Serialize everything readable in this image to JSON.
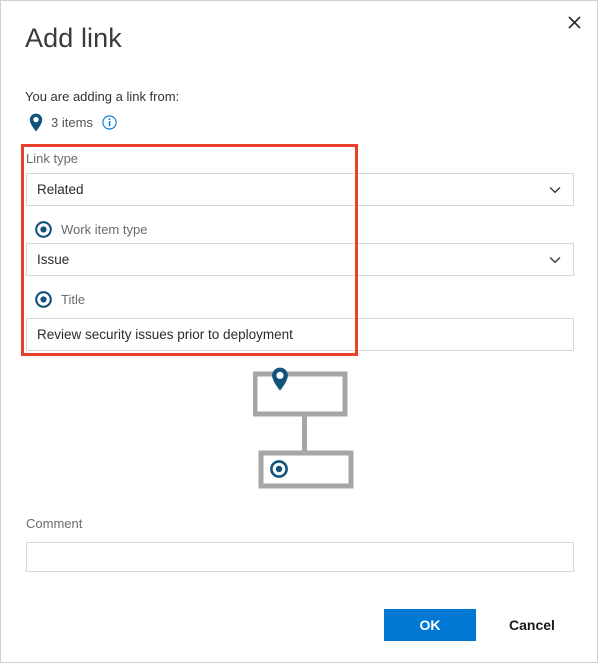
{
  "dialog": {
    "title": "Add link",
    "close_label": "Close"
  },
  "source": {
    "description": "You are adding a link from:",
    "items_count_label": "3 items",
    "pin_icon": "map-pin-icon",
    "info_icon": "info-circle-icon"
  },
  "form": {
    "link_type": {
      "label": "Link type",
      "value": "Related",
      "chevron_icon": "chevron-down-icon"
    },
    "work_item_type": {
      "label": "Work item type",
      "radio_icon": "radio-selected-icon",
      "value": "Issue",
      "chevron_icon": "chevron-down-icon"
    },
    "title": {
      "label": "Title",
      "radio_icon": "radio-selected-icon",
      "value": "Review security issues prior to deployment"
    },
    "comment": {
      "label": "Comment",
      "value": "",
      "placeholder": ""
    }
  },
  "diagram": {
    "parent_node_icon": "map-pin-icon",
    "child_node_icon": "radio-selected-icon"
  },
  "footer": {
    "ok_label": "OK",
    "cancel_label": "Cancel"
  },
  "colors": {
    "accent_blue": "#0078d4",
    "icon_navy": "#12537e",
    "highlight_red": "#e8402a",
    "border_gray": "#d6d6d6"
  }
}
